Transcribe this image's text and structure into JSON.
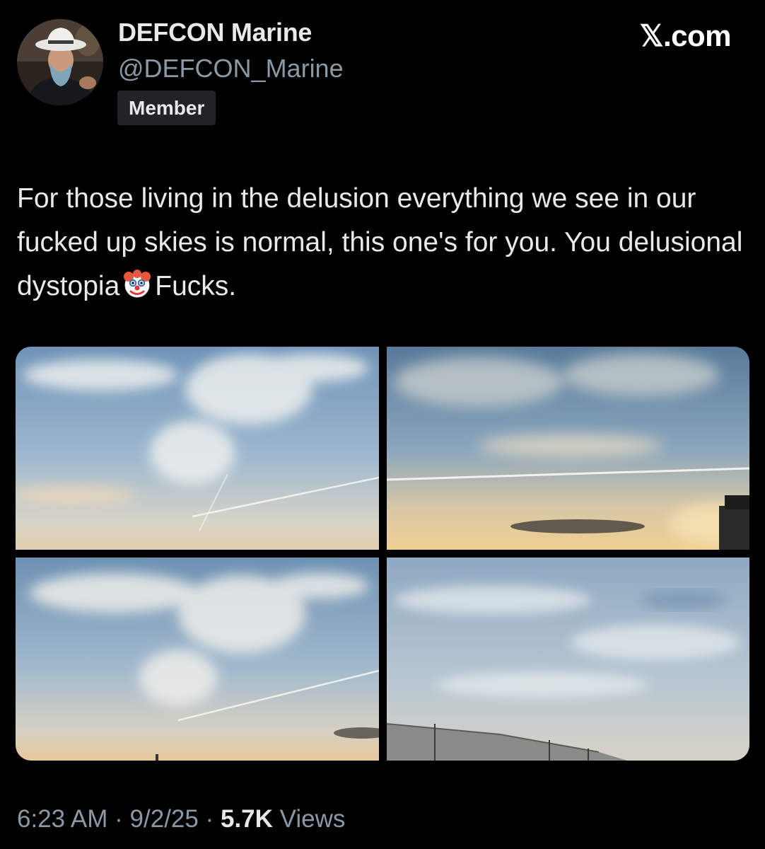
{
  "author": {
    "display_name": "DEFCON Marine",
    "handle": "@DEFCON_Marine",
    "badge": "Member",
    "avatar_icon": "profile-photo-cowboy-hat"
  },
  "brand": {
    "label": "𝕏.com"
  },
  "post": {
    "text_part1": "For those living in the delusion everything we see in our fucked up skies is normal, this one's for you. You delusional dystopia",
    "emoji_icon": "clown-face-emoji",
    "text_part2": "Fucks."
  },
  "media": {
    "photos": [
      {
        "name": "sky-photo-1"
      },
      {
        "name": "sky-photo-2"
      },
      {
        "name": "sky-photo-3"
      },
      {
        "name": "sky-photo-4"
      }
    ]
  },
  "meta": {
    "time": "6:23 AM",
    "date": "9/2/25",
    "separator": "·",
    "views_count": "5.7K",
    "views_label": "Views"
  },
  "colors": {
    "background": "#000000",
    "primary_text": "#e7e9ea",
    "secondary_text": "#8b98a5",
    "badge_bg": "#202327"
  }
}
